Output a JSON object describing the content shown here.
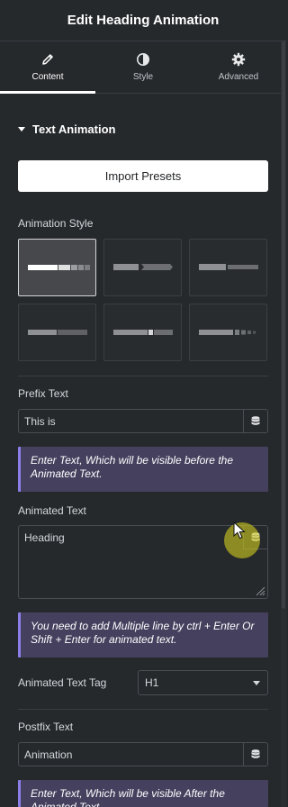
{
  "header": {
    "title": "Edit Heading Animation"
  },
  "tabs": [
    {
      "label": "Content",
      "icon": "pencil-icon",
      "active": true
    },
    {
      "label": "Style",
      "icon": "contrast-icon",
      "active": false
    },
    {
      "label": "Advanced",
      "icon": "gear-icon",
      "active": false
    }
  ],
  "section": {
    "title": "Text Animation"
  },
  "import_presets": {
    "label": "Import Presets"
  },
  "animation_style": {
    "label": "Animation Style",
    "options": [
      "style-1",
      "style-2",
      "style-3",
      "style-4",
      "style-5",
      "style-6"
    ],
    "selected": 0
  },
  "prefix": {
    "label": "Prefix Text",
    "value": "This is",
    "notice": "Enter Text, Which will be visible before the Animated Text."
  },
  "animated": {
    "label": "Animated Text",
    "value": "Heading",
    "notice": "You need to add Multiple line by ctrl + Enter Or Shift + Enter for animated text."
  },
  "tag": {
    "label": "Animated Text Tag",
    "value": "H1"
  },
  "postfix": {
    "label": "Postfix Text",
    "value": "Animation",
    "notice": "Enter Text, Which will be visible After the Animated Text."
  },
  "colors": {
    "accent": "#8c7ee8",
    "notice_bg": "#45405e",
    "panel_bg": "#26292c"
  }
}
